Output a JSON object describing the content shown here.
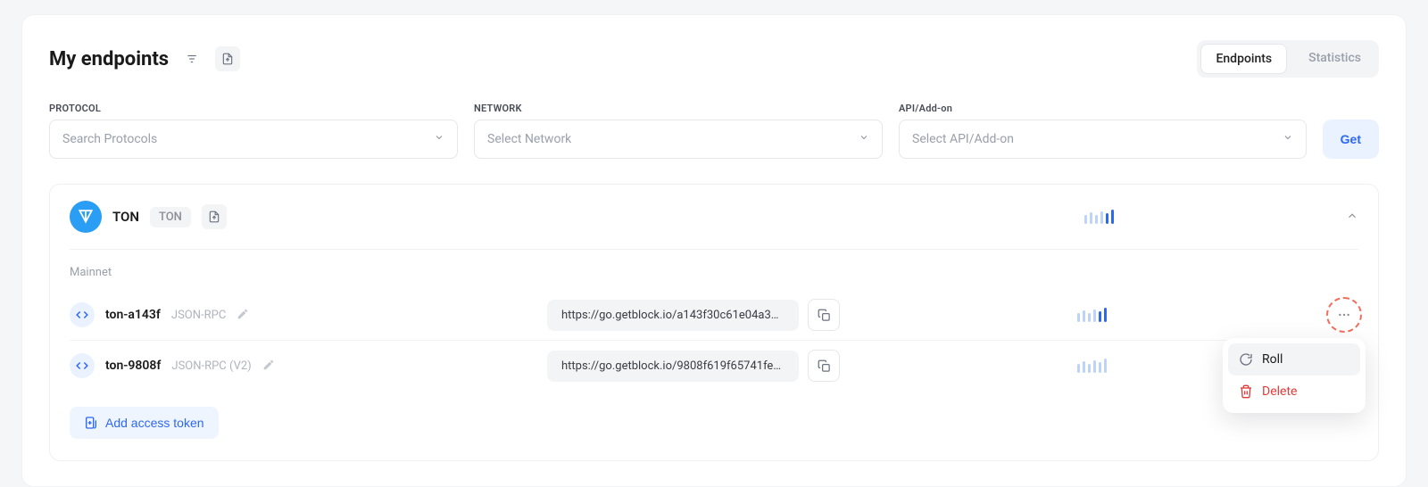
{
  "header": {
    "title": "My endpoints",
    "tabs": {
      "endpoints": "Endpoints",
      "statistics": "Statistics"
    }
  },
  "filters": {
    "protocol": {
      "label": "PROTOCOL",
      "placeholder": "Search Protocols"
    },
    "network": {
      "label": "NETWORK",
      "placeholder": "Select Network"
    },
    "api": {
      "label": "API/Add-on",
      "placeholder": "Select API/Add-on"
    },
    "get": "Get"
  },
  "protocol": {
    "name": "TON",
    "tag": "TON",
    "network": "Mainnet",
    "endpoints": [
      {
        "name": "ton-a143f",
        "type": "JSON-RPC",
        "url": "https://go.getblock.io/a143f30c61e04a34ad6..."
      },
      {
        "name": "ton-9808f",
        "type": "JSON-RPC (V2)",
        "url": "https://go.getblock.io/9808f619f65741febda1..."
      }
    ]
  },
  "actions": {
    "add_token": "Add access token",
    "menu": {
      "roll": "Roll",
      "delete": "Delete"
    }
  }
}
